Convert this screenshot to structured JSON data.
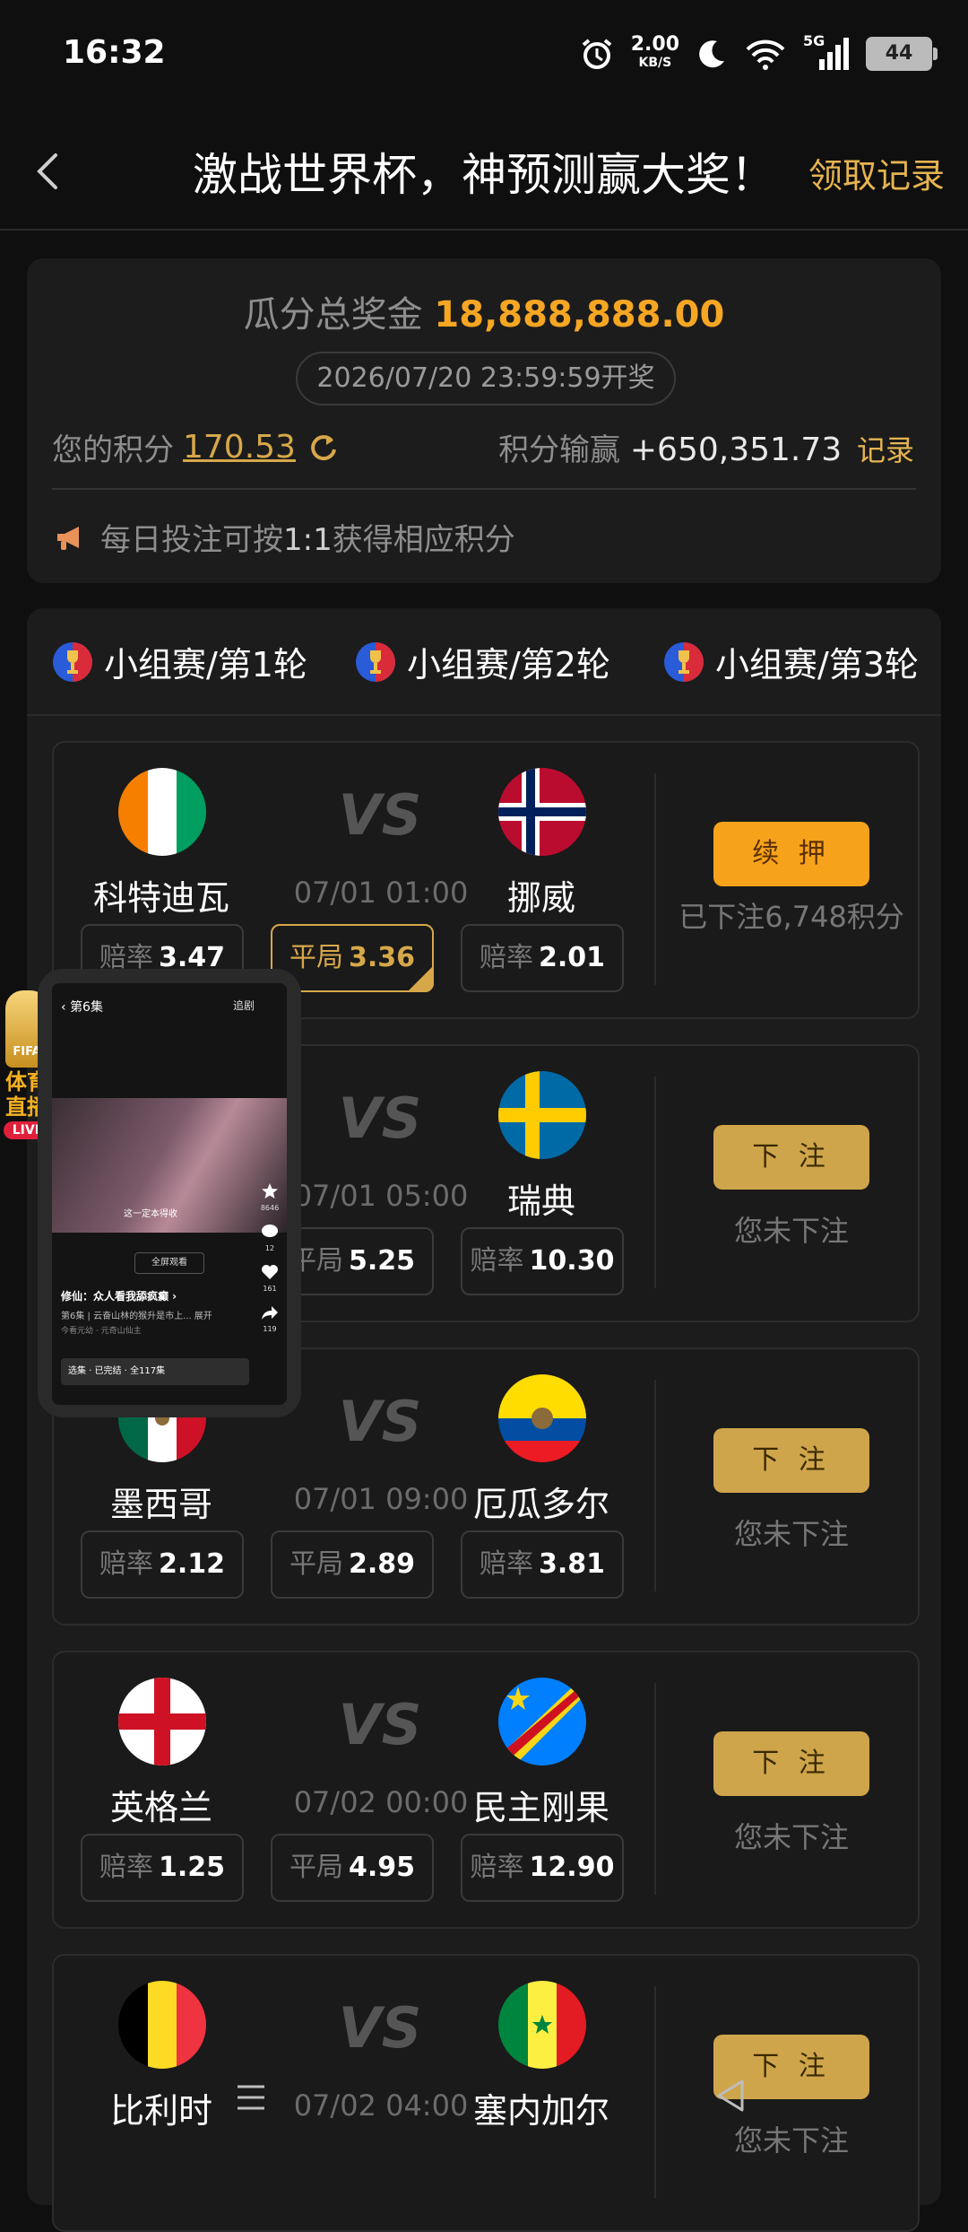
{
  "status_bar": {
    "time": "16:32",
    "net_speed_value": "2.00",
    "net_speed_unit": "KB/S",
    "network": "5G",
    "battery": "44"
  },
  "header": {
    "title": "激战世界杯，神预测赢大奖！",
    "records_link": "领取记录"
  },
  "prize": {
    "label": "瓜分总奖金",
    "amount": "18,888,888.00",
    "draw_time": "2026/07/20 23:59:59开奖",
    "points_label": "您的积分",
    "points_value": "170.53",
    "winloss_label": "积分输赢",
    "winloss_value": "+650,351.73",
    "winloss_record": "记录",
    "notice_prefix": "每日投注可按",
    "notice_ratio": "1:1",
    "notice_suffix": "获得相应积分"
  },
  "tabs": [
    {
      "label": "小组赛/第1轮"
    },
    {
      "label": "小组赛/第2轮"
    },
    {
      "label": "小组赛/第3轮"
    }
  ],
  "matches": [
    {
      "home": "科特迪瓦",
      "away": "挪威",
      "time": "07/01 01:00",
      "vs": "VS",
      "home_odds_label": "赔率",
      "home_odds": "3.47",
      "draw_label": "平局",
      "draw_odds": "3.36",
      "away_odds_label": "赔率",
      "away_odds": "2.01",
      "button": "续 押",
      "status": "已下注6,748积分"
    },
    {
      "home": "",
      "away": "瑞典",
      "time": "07/01 05:00",
      "vs": "VS",
      "home_odds_label": "",
      "home_odds": "",
      "draw_label": "平局",
      "draw_odds": "5.25",
      "away_odds_label": "赔率",
      "away_odds": "10.30",
      "button": "下 注",
      "status": "您未下注"
    },
    {
      "home": "墨西哥",
      "away": "厄瓜多尔",
      "time": "07/01 09:00",
      "vs": "VS",
      "home_odds_label": "赔率",
      "home_odds": "2.12",
      "draw_label": "平局",
      "draw_odds": "2.89",
      "away_odds_label": "赔率",
      "away_odds": "3.81",
      "button": "下 注",
      "status": "您未下注"
    },
    {
      "home": "英格兰",
      "away": "民主刚果",
      "time": "07/02 00:00",
      "vs": "VS",
      "home_odds_label": "赔率",
      "home_odds": "1.25",
      "draw_label": "平局",
      "draw_odds": "4.95",
      "away_odds_label": "赔率",
      "away_odds": "12.90",
      "button": "下 注",
      "status": "您未下注"
    },
    {
      "home": "比利时",
      "away": "塞内加尔",
      "time": "07/02 04:00",
      "vs": "VS",
      "home_odds_label": "",
      "home_odds": "",
      "draw_label": "",
      "draw_odds": "",
      "away_odds_label": "",
      "away_odds": "",
      "button": "下 注",
      "status": "您未下注"
    }
  ],
  "floating_player": {
    "episode": "第6集",
    "follow": "追剧",
    "caption": "这一定本得收",
    "fullscreen": "全屏观看",
    "drama_title": "修仙：众人看我舔疯癫 ›",
    "episode_line": "第6集 | 云奋山林的猴升是市上...  展开",
    "sub_line": "今看元幼 · 元奇山仙主",
    "bar_text": "选集 · 已完结 · 全117集",
    "likes": "8646",
    "comments": "12",
    "hearts": "161",
    "shares": "119"
  },
  "fifa_badge": {
    "cup_text": "FIFA",
    "label": "体育直播",
    "live": "LIVE"
  },
  "colors": {
    "accent_gold": "#e6b450",
    "prize_orange": "#f5a623",
    "bet_button": "#cfa54b",
    "continue_button": "#f7a21b"
  }
}
